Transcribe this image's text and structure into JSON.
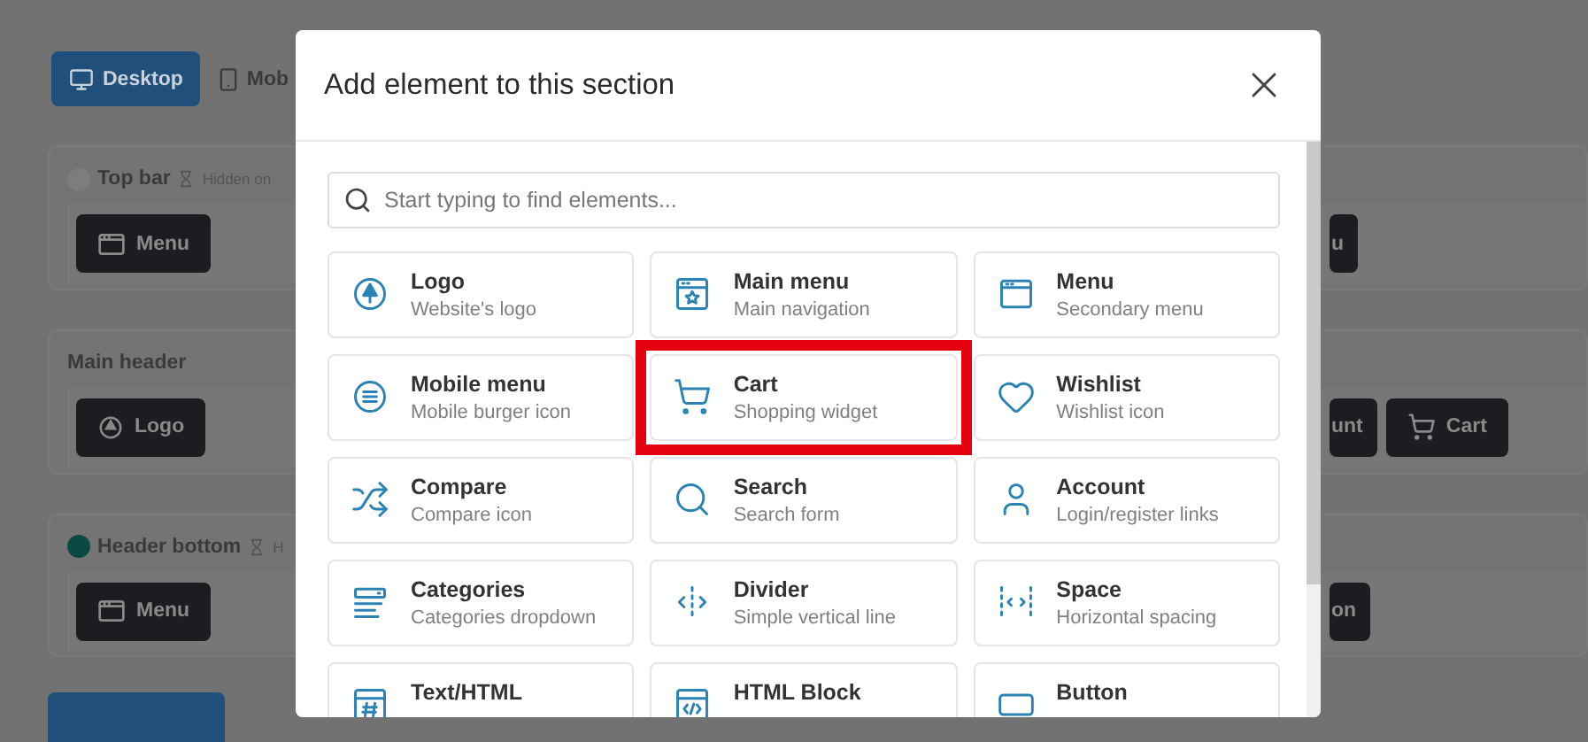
{
  "background": {
    "device_tabs": [
      {
        "label": "Desktop",
        "selected": true
      },
      {
        "label": "Mob",
        "selected": false
      }
    ],
    "sections": [
      {
        "title": "Top bar",
        "color": "#7d7d7d",
        "hidden_note": "Hidden on",
        "left_items": [
          {
            "label": "Menu",
            "kind": "menu"
          }
        ],
        "right_items": [
          {
            "label": "u",
            "kind": "clipped"
          }
        ]
      },
      {
        "title": "Main header",
        "left_items": [
          {
            "label": "Logo",
            "kind": "logo"
          }
        ],
        "right_items": [
          {
            "label": "unt",
            "kind": "clipped"
          },
          {
            "label": "Cart",
            "kind": "cart"
          }
        ]
      },
      {
        "title": "Header bottom",
        "color": "#0a4a44",
        "hidden_note": "H",
        "left_items": [
          {
            "label": "Menu",
            "kind": "menu"
          }
        ],
        "right_items": [
          {
            "label": "on",
            "kind": "clipped"
          }
        ]
      }
    ]
  },
  "modal": {
    "title": "Add element to this section",
    "search": {
      "placeholder": "Start typing to find elements..."
    },
    "elements": [
      {
        "title": "Logo",
        "subtitle": "Website's logo",
        "highlighted": false
      },
      {
        "title": "Main menu",
        "subtitle": "Main navigation",
        "highlighted": false
      },
      {
        "title": "Menu",
        "subtitle": "Secondary menu",
        "highlighted": false
      },
      {
        "title": "Mobile menu",
        "subtitle": "Mobile burger icon",
        "highlighted": false
      },
      {
        "title": "Cart",
        "subtitle": "Shopping widget",
        "highlighted": true
      },
      {
        "title": "Wishlist",
        "subtitle": "Wishlist icon",
        "highlighted": false
      },
      {
        "title": "Compare",
        "subtitle": "Compare icon",
        "highlighted": false
      },
      {
        "title": "Search",
        "subtitle": "Search form",
        "highlighted": false
      },
      {
        "title": "Account",
        "subtitle": "Login/register links",
        "highlighted": false
      },
      {
        "title": "Categories",
        "subtitle": "Categories dropdown",
        "highlighted": false
      },
      {
        "title": "Divider",
        "subtitle": "Simple vertical line",
        "highlighted": false
      },
      {
        "title": "Space",
        "subtitle": "Horizontal spacing",
        "highlighted": false
      },
      {
        "title": "Text/HTML",
        "highlighted": false
      },
      {
        "title": "HTML Block",
        "highlighted": false
      },
      {
        "title": "Button",
        "highlighted": false
      }
    ]
  }
}
